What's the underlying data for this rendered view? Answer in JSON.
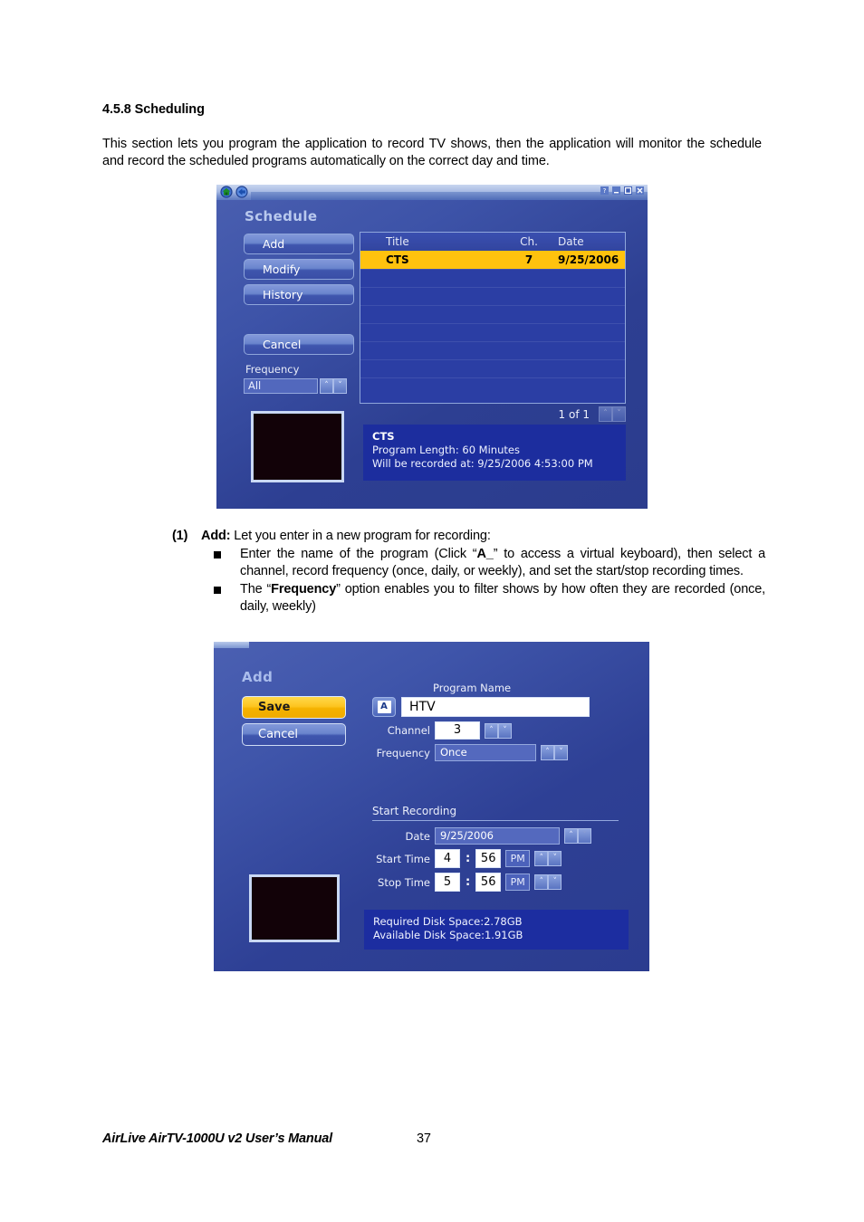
{
  "document": {
    "heading": "4.5.8 Scheduling",
    "intro": "This section lets you program the application to record TV shows, then the application will monitor the schedule and record the scheduled programs automatically on the correct day and time.",
    "list": {
      "number": "(1)",
      "lead": "Add:",
      "lead_rest": " Let you enter in a new program for recording:",
      "bullets": [
        {
          "pre": "Enter the name of the program (Click “",
          "bold": "A_",
          "post": "” to access a virtual keyboard), then select a channel, record frequency (once, daily, or weekly), and set the start/stop recording times."
        },
        {
          "pre": "The “",
          "bold": "Frequency",
          "post": "” option enables you to filter shows by how often they are recorded (once, daily, weekly)"
        }
      ]
    },
    "footer": {
      "manual_title": "AirLive AirTV-1000U v2 User’s Manual",
      "page_number": "37"
    }
  },
  "schedule_window": {
    "titlebar": {
      "home_icon": "home-icon",
      "back_icon": "back-arrow-icon",
      "help_label": "?",
      "minimize_label": "_",
      "maximize_label": "□",
      "close_label": "✖"
    },
    "title": "Schedule",
    "buttons": {
      "add": "Add",
      "modify": "Modify",
      "history": "History",
      "cancel": "Cancel"
    },
    "frequency": {
      "label": "Frequency",
      "value": "All",
      "up_icon": "˄",
      "down_icon": "˅"
    },
    "list": {
      "columns": {
        "title": "Title",
        "channel": "Ch.",
        "date": "Date"
      },
      "rows": [
        {
          "title": "CTS",
          "channel": "7",
          "date": "9/25/2006",
          "selected": true
        }
      ],
      "empty_row_count": 7
    },
    "pager": {
      "label": "1 of 1",
      "up_icon": "˄",
      "down_icon": "˅"
    },
    "preview": {
      "name": "video-preview-thumbnail"
    },
    "info": {
      "title": "CTS",
      "line1": "Program Length: 60 Minutes",
      "line2": "Will be recorded at: 9/25/2006 4:53:00 PM"
    }
  },
  "add_window": {
    "title": "Add",
    "buttons": {
      "save": "Save",
      "cancel": "Cancel"
    },
    "program_name": {
      "label": "Program Name",
      "keyboard_button_glyph": "A",
      "value": "HTV"
    },
    "channel": {
      "label": "Channel",
      "value": "3",
      "up_icon": "˄",
      "down_icon": "˅"
    },
    "frequency": {
      "label": "Frequency",
      "value": "Once",
      "up_icon": "˄",
      "down_icon": "˅"
    },
    "start_recording": {
      "section_title": "Start Recording",
      "date": {
        "label": "Date",
        "value": "9/25/2006",
        "up_icon": "˄",
        "down_icon": "˅"
      },
      "start_time": {
        "label": "Start Time",
        "hour": "4",
        "separator": ":",
        "minute": "56",
        "meridiem": "PM",
        "up_icon": "˄",
        "down_icon": "˅"
      },
      "stop_time": {
        "label": "Stop Time",
        "hour": "5",
        "separator": ":",
        "minute": "56",
        "meridiem": "PM",
        "up_icon": "˄",
        "down_icon": "˅"
      }
    },
    "disk": {
      "required": "Required Disk Space:2.78GB",
      "available": "Available Disk Space:1.91GB"
    },
    "preview": {
      "name": "video-preview-thumbnail"
    }
  },
  "colors": {
    "selected_row": "#ffc20e",
    "save_button": "#fdc521",
    "window_blue": "#2e4095",
    "list_blue": "#2b3ea4",
    "info_panel": "#1c2d9e"
  }
}
